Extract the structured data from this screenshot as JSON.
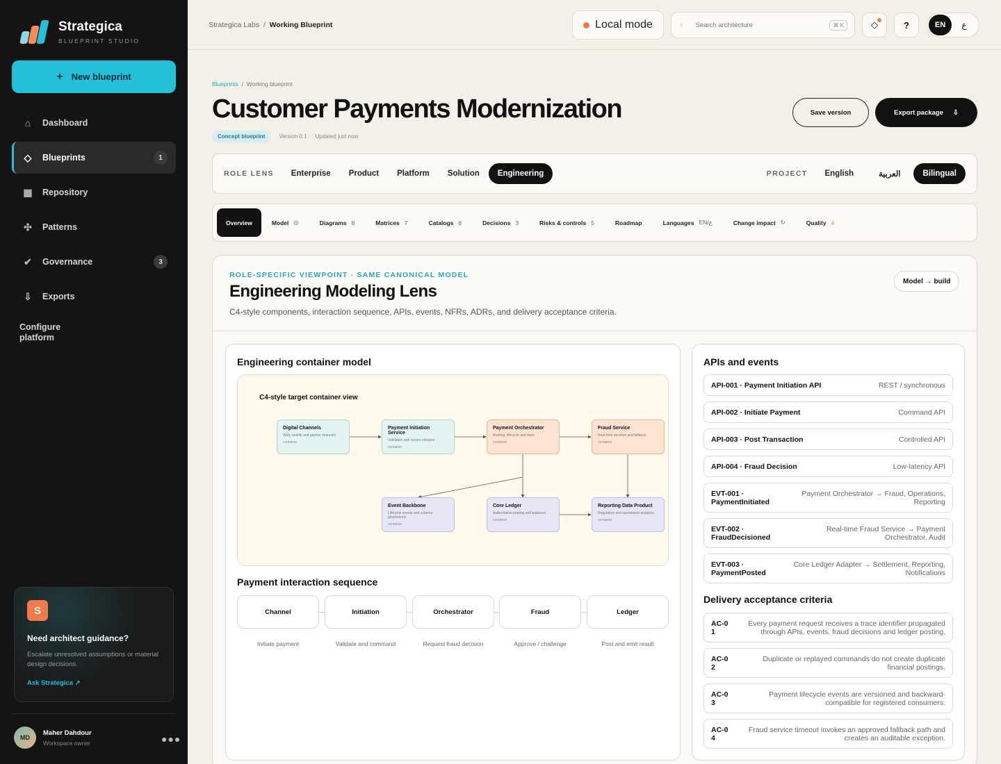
{
  "brand": {
    "name": "Strategica",
    "sub": "BLUEPRINT STUDIO"
  },
  "sidebar": {
    "new_button": "New blueprint",
    "items": [
      {
        "label": "Dashboard",
        "icon": "home-icon",
        "badge": ""
      },
      {
        "label": "Blueprints",
        "icon": "diamond-icon",
        "badge": "1"
      },
      {
        "label": "Repository",
        "icon": "grid-icon",
        "badge": ""
      },
      {
        "label": "Patterns",
        "icon": "nodes-icon",
        "badge": ""
      },
      {
        "label": "Governance",
        "icon": "check-icon",
        "badge": "3"
      },
      {
        "label": "Exports",
        "icon": "download-icon",
        "badge": ""
      }
    ],
    "configure": "Configure platform",
    "guide": {
      "badge": "S",
      "title": "Need architect guidance?",
      "desc": "Escalate unresolved assumptions or material design decisions.",
      "link": "Ask Strategica ↗"
    },
    "user": {
      "initials": "MD",
      "name": "Maher Dahdour",
      "role": "Workspace owner"
    }
  },
  "topbar": {
    "crumb_root": "Strategica Labs",
    "crumb_sep": "/",
    "crumb_current": "Working Blueprint",
    "mode": "Local mode",
    "search_placeholder": "Search architecture",
    "search_kbd": "⌘ K",
    "help": "?",
    "lang_en": "EN",
    "lang_ar": "ع"
  },
  "page": {
    "crumb_link": "Blueprints",
    "crumb_sep": "/",
    "crumb_current": "Working blueprint",
    "title": "Customer Payments Modernization",
    "chip": "Concept blueprint",
    "version": "Version 0.1",
    "updated": "Updated just now",
    "save": "Save version",
    "export": "Export package"
  },
  "lens": {
    "label": "ROLE LENS",
    "items": [
      "Enterprise",
      "Product",
      "Platform",
      "Solution",
      "Engineering"
    ],
    "active": "Engineering",
    "project_label": "PROJECT",
    "project_items": [
      "English",
      "العربية",
      "Bilingual"
    ],
    "project_active": "Bilingual"
  },
  "tabs": [
    {
      "label": "Overview",
      "count": ""
    },
    {
      "label": "Model",
      "count": "◎"
    },
    {
      "label": "Diagrams",
      "count": "8"
    },
    {
      "label": "Matrices",
      "count": "7"
    },
    {
      "label": "Catalogs",
      "count": "8"
    },
    {
      "label": "Decisions",
      "count": "3"
    },
    {
      "label": "Risks & controls",
      "count": "5"
    },
    {
      "label": "Roadmap",
      "count": ""
    },
    {
      "label": "Languages",
      "count": "EN/ع"
    },
    {
      "label": "Change impact",
      "count": "↻"
    },
    {
      "label": "Quality",
      "count": "4"
    }
  ],
  "panel": {
    "kicker": "ROLE-SPECIFIC VIEWPOINT · SAME CANONICAL MODEL",
    "title": "Engineering Modeling Lens",
    "subtitle": "C4-style components, interaction sequence, APIs, events, NFRs, ADRs, and delivery acceptance criteria.",
    "model_button": "Model → build"
  },
  "container": {
    "title": "Engineering container model",
    "diagram_title": "C4-style target container view",
    "boxes": [
      {
        "name": "Digital Channels",
        "desc": "Web, mobile and partner channels",
        "kind": "container"
      },
      {
        "name": "Payment Initiation Service",
        "desc": "Validation and secure initiation",
        "kind": "container"
      },
      {
        "name": "Payment Orchestrator",
        "desc": "Routing, lifecycle and state",
        "kind": "container"
      },
      {
        "name": "Fraud Service",
        "desc": "Real-time decision and fallback",
        "kind": "container"
      },
      {
        "name": "Event Backbone",
        "desc": "Lifecycle events and schema governance",
        "kind": "container"
      },
      {
        "name": "Core Ledger",
        "desc": "Authoritative posting and balances",
        "kind": "container"
      },
      {
        "name": "Reporting Data Product",
        "desc": "Regulatory and operational analytics",
        "kind": "container"
      }
    ]
  },
  "sequence": {
    "title": "Payment interaction sequence",
    "steps": [
      {
        "actor": "Channel",
        "action": "Initiate payment"
      },
      {
        "actor": "Initiation",
        "action": "Validate and command"
      },
      {
        "actor": "Orchestrator",
        "action": "Request fraud decision"
      },
      {
        "actor": "Fraud",
        "action": "Approve / challenge"
      },
      {
        "actor": "Ledger",
        "action": "Post and emit result"
      }
    ]
  },
  "apis": {
    "title": "APIs and events",
    "items": [
      {
        "id": "API-001 · Payment Initiation API",
        "desc": "REST / synchronous"
      },
      {
        "id": "API-002 · Initiate Payment",
        "desc": "Command API"
      },
      {
        "id": "API-003 · Post Transaction",
        "desc": "Controlled API"
      },
      {
        "id": "API-004 · Fraud Decision",
        "desc": "Low-latency API"
      },
      {
        "id": "EVT-001 · PaymentInitiated",
        "desc": "Payment Orchestrator → Fraud, Operations, Reporting"
      },
      {
        "id": "EVT-002 · FraudDecisioned",
        "desc": "Real-time Fraud Service → Payment Orchestrator, Audit"
      },
      {
        "id": "EVT-003 · PaymentPosted",
        "desc": "Core Ledger Adapter → Settlement, Reporting, Notifications"
      }
    ]
  },
  "acceptance": {
    "title": "Delivery acceptance criteria",
    "items": [
      {
        "id": "AC-01",
        "desc": "Every payment request receives a trace identifier propagated through APIs, events, fraud decisions and ledger posting."
      },
      {
        "id": "AC-02",
        "desc": "Duplicate or replayed commands do not create duplicate financial postings."
      },
      {
        "id": "AC-03",
        "desc": "Payment lifecycle events are versioned and backward-compatible for registered consumers."
      },
      {
        "id": "AC-04",
        "desc": "Fraud service timeout invokes an approved fallback path and creates an auditable exception."
      }
    ]
  },
  "colors": {
    "accent": "#22c1d9",
    "sidebar": "#141414",
    "warm": "#f07a4a",
    "box_teal": "#e3f5f3",
    "box_orange": "#fde3d0",
    "box_lav": "#e6e6f7"
  }
}
